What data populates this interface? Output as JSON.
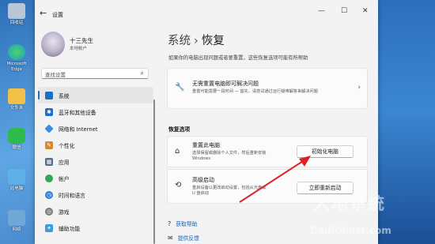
{
  "desktop": {
    "icons": [
      {
        "label": "回收站",
        "color": "#b8c6d6",
        "icon": "recycle-bin-icon"
      },
      {
        "label": "Microsoft Edge",
        "color": "#1aa0c8",
        "icon": "edge-icon"
      },
      {
        "label": "文件夹",
        "color": "#f0c048",
        "icon": "folder-icon"
      },
      {
        "label": "微信",
        "color": "#2dbb4e",
        "icon": "wechat-icon"
      },
      {
        "label": "此电脑",
        "color": "#5fb0e8",
        "icon": "computer-icon"
      },
      {
        "label": "网络",
        "color": "#6fa8d8",
        "icon": "network-icon"
      }
    ]
  },
  "window": {
    "app_title": "设置",
    "controls": {
      "minimize": "—",
      "maximize": "☐",
      "close": "✕"
    }
  },
  "profile": {
    "name": "十三先生",
    "account": "本地帐户"
  },
  "search": {
    "placeholder": "查找设置"
  },
  "nav": [
    {
      "label": "系统",
      "color": "#1a6fcc",
      "glyph": "▬",
      "selected": true
    },
    {
      "label": "蓝牙和其他设备",
      "color": "#1a6fcc",
      "glyph": "✱"
    },
    {
      "label": "网络和 Internet",
      "color": "#3a8de0",
      "glyph": "◆"
    },
    {
      "label": "个性化",
      "color": "#d88a2a",
      "glyph": "✎"
    },
    {
      "label": "应用",
      "color": "#5a6b8c",
      "glyph": "▦"
    },
    {
      "label": "帐户",
      "color": "#2fa85a",
      "glyph": "●"
    },
    {
      "label": "时间和语言",
      "color": "#2a7fd4",
      "glyph": "◷"
    },
    {
      "label": "游戏",
      "color": "#7a7a7a",
      "glyph": "◎"
    },
    {
      "label": "辅助功能",
      "color": "#3a9de0",
      "glyph": "✦"
    }
  ],
  "page": {
    "breadcrumb_parent": "系统",
    "breadcrumb_sep": "›",
    "breadcrumb_current": "恢复",
    "description": "如果你的电脑出现问题或者要重置，这些恢复选项可能有所帮助",
    "fix_card": {
      "title": "无需重置电脑即可解决问题",
      "subtitle": "重置可能需要一段时间 — 首先，请尝试通过运行疑难解答来解决问题"
    },
    "section_title": "恢复选项",
    "reset_card": {
      "title": "重置此电脑",
      "subtitle_line1": "选择保留或删除个人文件，然后重新安装",
      "subtitle_line2": "Windows",
      "button": "初始化电脑"
    },
    "advanced_card": {
      "title": "高级启动",
      "subtitle_line1": "重启设备以更改启动设置，包括从光盘或",
      "subtitle_line2": "U 盘启动",
      "button": "立即重新启动"
    },
    "links": [
      {
        "label": "获取帮助"
      },
      {
        "label": "提供反馈"
      }
    ]
  },
  "watermark": {
    "line1": "大地系统",
    "line2": "DadiGhost.com"
  },
  "colors": {
    "accent": "#1a6fcc",
    "annotation_arrow": "#e02020"
  }
}
